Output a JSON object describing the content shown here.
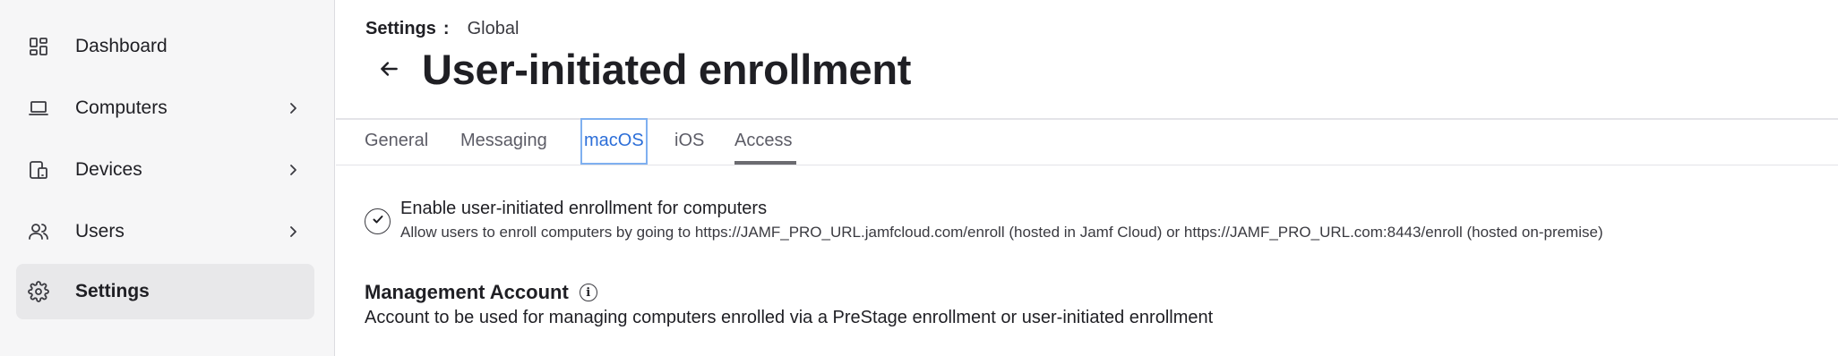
{
  "sidebar": {
    "items": [
      {
        "label": "Dashboard",
        "icon": "dashboard-icon",
        "chevron": false,
        "active": false
      },
      {
        "label": "Computers",
        "icon": "laptop-icon",
        "chevron": true,
        "active": false
      },
      {
        "label": "Devices",
        "icon": "devices-icon",
        "chevron": true,
        "active": false
      },
      {
        "label": "Users",
        "icon": "users-icon",
        "chevron": true,
        "active": false
      },
      {
        "label": "Settings",
        "icon": "gear-icon",
        "chevron": false,
        "active": true
      }
    ]
  },
  "breadcrumb": {
    "root": "Settings",
    "separator": ":",
    "current": "Global"
  },
  "header": {
    "title": "User-initiated enrollment",
    "back_icon": "arrow-left-icon"
  },
  "tabs": [
    {
      "label": "General"
    },
    {
      "label": "Messaging"
    },
    {
      "label": "macOS",
      "focused": true
    },
    {
      "label": "iOS"
    },
    {
      "label": "Access",
      "selected": true
    }
  ],
  "enrollment": {
    "checkbox_label": "Enable user-initiated enrollment for computers",
    "checkbox_description": "Allow users to enroll computers by going to https://JAMF_PRO_URL.jamfcloud.com/enroll (hosted in Jamf Cloud) or https://JAMF_PRO_URL.com:8443/enroll (hosted on-premise)",
    "checked": true
  },
  "management_account": {
    "title": "Management Account",
    "info_glyph": "i",
    "description": "Account to be used for managing computers enrolled via a PreStage enrollment or user-initiated enrollment"
  },
  "colors": {
    "focus_blue": "#2c6ed8",
    "sidebar_bg": "#f6f6f7",
    "active_item_bg": "#e8e8ea"
  }
}
